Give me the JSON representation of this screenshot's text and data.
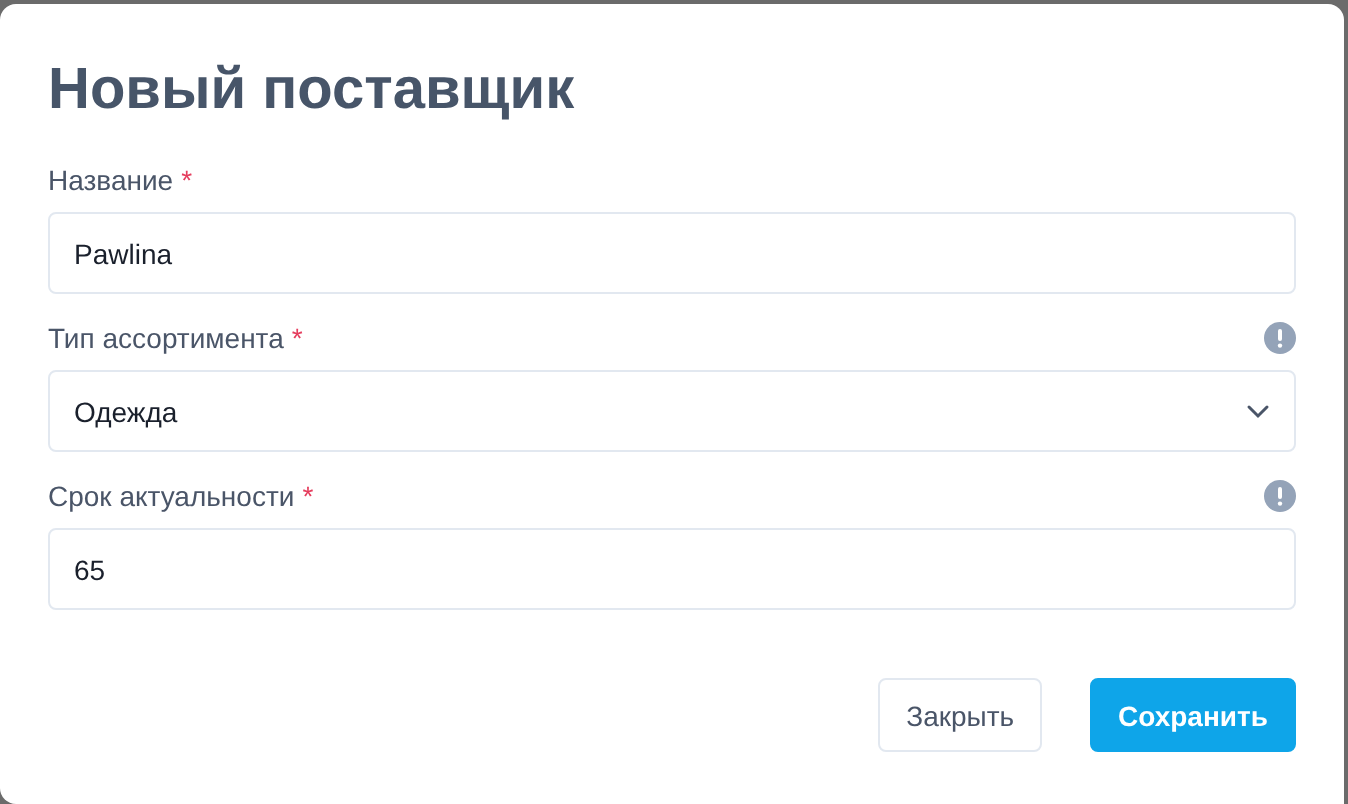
{
  "dialog": {
    "title": "Новый поставщик",
    "fields": [
      {
        "kind": "text",
        "label": "Название",
        "required_mark": "*",
        "hint": false,
        "value": "Pawlina"
      },
      {
        "kind": "select",
        "label": "Тип ассортимента",
        "required_mark": "*",
        "hint": true,
        "value": "Одежда"
      },
      {
        "kind": "text",
        "label": "Срок актуальности",
        "required_mark": "*",
        "hint": true,
        "value": "65"
      }
    ],
    "buttons": [
      {
        "label": "Закрыть",
        "kind": "secondary"
      },
      {
        "label": "Сохранить",
        "kind": "primary"
      }
    ]
  }
}
